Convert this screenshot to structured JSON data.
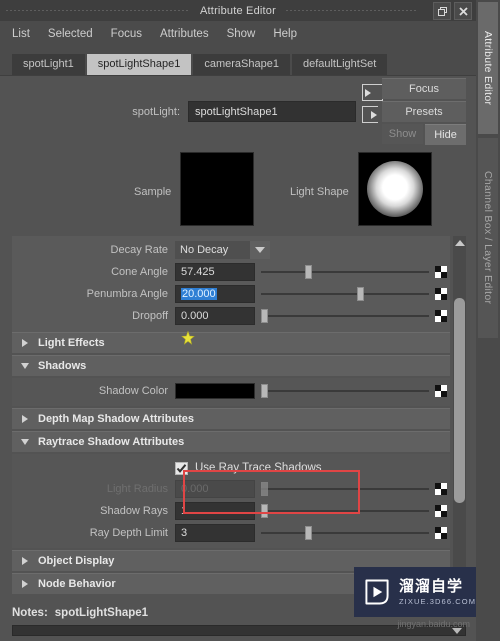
{
  "window": {
    "title": "Attribute Editor",
    "restore_icon": "restore-icon",
    "close_icon": "close-icon"
  },
  "menubar": {
    "items": [
      {
        "label": "List"
      },
      {
        "label": "Selected"
      },
      {
        "label": "Focus"
      },
      {
        "label": "Attributes"
      },
      {
        "label": "Show"
      },
      {
        "label": "Help"
      }
    ]
  },
  "node_tabs": [
    {
      "label": "spotLight1",
      "active": false
    },
    {
      "label": "spotLightShape1",
      "active": true
    },
    {
      "label": "cameraShape1",
      "active": false
    },
    {
      "label": "defaultLightSet",
      "active": false
    }
  ],
  "identity": {
    "type_label": "spotLight:",
    "node_name": "spotLightShape1",
    "focus_button": "Focus",
    "presets_button": "Presets",
    "show_button": "Show",
    "hide_button": "Hide"
  },
  "previews": {
    "sample_label": "Sample",
    "light_shape_label": "Light Shape"
  },
  "spot_attributes": [
    {
      "label": "Decay Rate",
      "value": "No Decay",
      "kind": "dropdown"
    },
    {
      "label": "Cone Angle",
      "value": "57.425",
      "kind": "slider",
      "thumb_pct": 26,
      "selected": false
    },
    {
      "label": "Penumbra Angle",
      "value": "20.000",
      "kind": "slider",
      "thumb_pct": 57,
      "selected": true
    },
    {
      "label": "Dropoff",
      "value": "0.000",
      "kind": "slider",
      "thumb_pct": 1,
      "selected": false
    }
  ],
  "sections": {
    "light_effects": {
      "label": "Light Effects",
      "expanded": false
    },
    "shadows": {
      "label": "Shadows",
      "expanded": true
    },
    "depth_map": {
      "label": "Depth Map Shadow Attributes",
      "expanded": false
    },
    "raytrace": {
      "label": "Raytrace Shadow Attributes",
      "expanded": true
    },
    "object_display": {
      "label": "Object Display",
      "expanded": false
    },
    "node_behavior": {
      "label": "Node Behavior",
      "expanded": false
    }
  },
  "shadow_color": {
    "label": "Shadow Color",
    "value": "#000000",
    "thumb_pct": 1
  },
  "raytrace_attributes": {
    "use_ray_trace_shadows": {
      "label": "Use Ray Trace Shadows",
      "checked": true
    },
    "rows": [
      {
        "label": "Light Radius",
        "value": "0.000",
        "thumb_pct": 1,
        "disabled": true
      },
      {
        "label": "Shadow Rays",
        "value": "1",
        "thumb_pct": 1,
        "disabled": false
      },
      {
        "label": "Ray Depth Limit",
        "value": "3",
        "thumb_pct": 26,
        "disabled": false
      }
    ]
  },
  "notes": {
    "label": "Notes:",
    "value": "spotLightShape1"
  },
  "dock_tabs": [
    {
      "label": "Attribute Editor",
      "active": true
    },
    {
      "label": "Channel Box / Layer Editor",
      "active": false
    }
  ],
  "watermark": {
    "cn": "溜溜自学",
    "en": "ZIXUE.3D66.COM",
    "sub": "jingyan.baidu.com"
  },
  "colors": {
    "accent_red": "#e04545",
    "selection_blue": "#2f7fd4",
    "panel": "#535353"
  }
}
